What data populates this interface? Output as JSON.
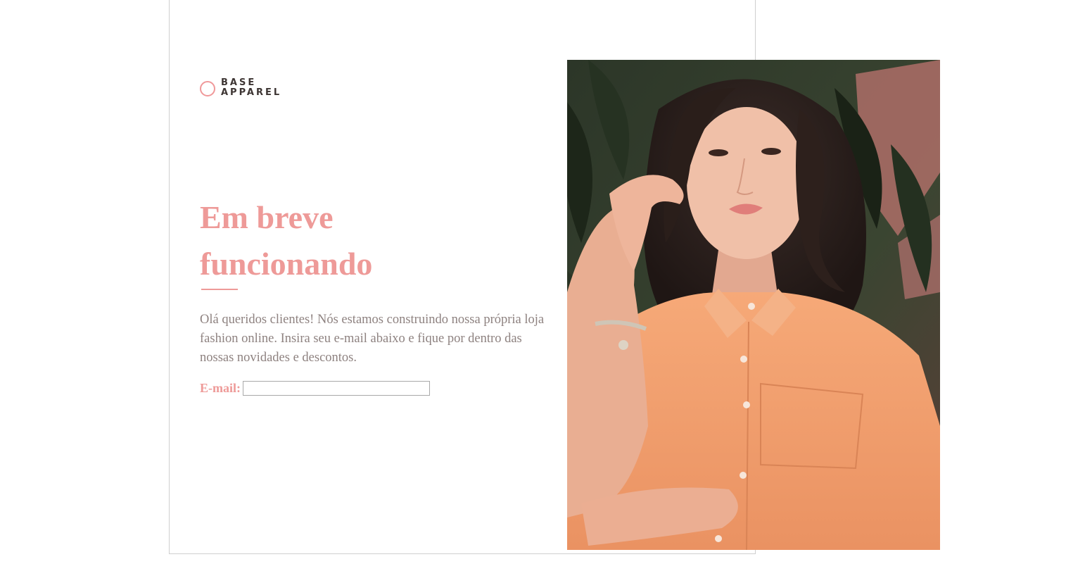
{
  "brand": {
    "line1": "BASE",
    "line2": "APPAREL",
    "accent_color": "#ee9a98",
    "icon": "circle-logo-icon"
  },
  "hero": {
    "headline_line1": "Em breve",
    "headline_line2": "funcionando",
    "intro": "Olá queridos clientes! Nós estamos construindo nossa própria loja fashion online. Insira seu e-mail abaixo e fique por dentro das nossas novidades e descontos."
  },
  "signup": {
    "label": "E-mail:",
    "value": "",
    "placeholder": ""
  },
  "photo": {
    "subject": "woman in peach shirt among tropical leaves"
  }
}
